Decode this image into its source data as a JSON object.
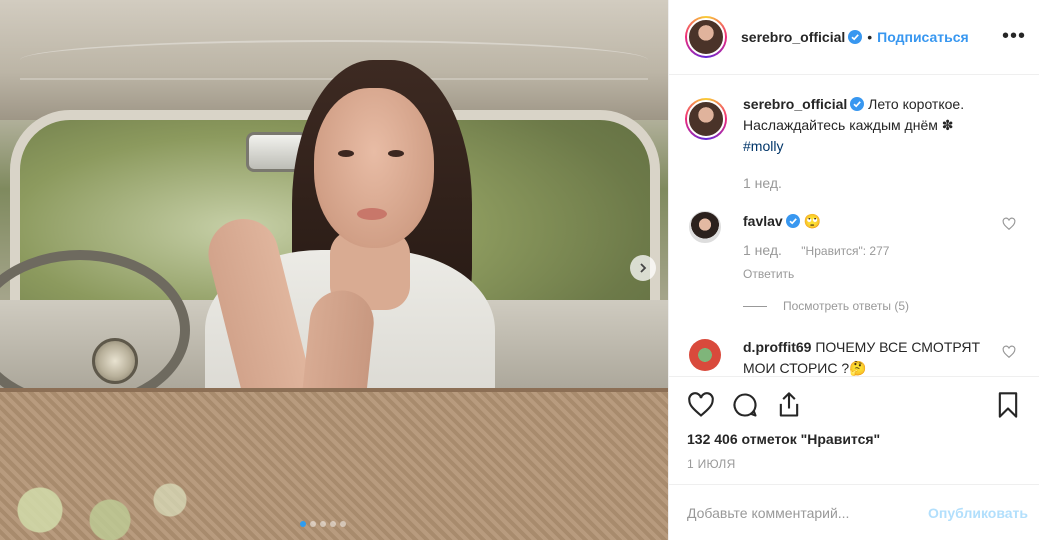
{
  "post": {
    "username": "serebro_official",
    "follow_label": "Подписаться",
    "more_label": "•••",
    "caption_text": "Лето короткое. Наслаждайтесь каждым днём ✽",
    "hashtag": "#molly",
    "caption_time": "1 нед."
  },
  "comments": [
    {
      "username": "favlav",
      "text": "🙄",
      "time": "1 нед.",
      "likes": "\"Нравится\": 277",
      "reply_label": "Ответить",
      "view_replies": "Посмотреть ответы (5)"
    },
    {
      "username": "d.proffit69",
      "text": "ПОЧЕМУ ВСЕ СМОТРЯТ МОИ СТОРИС ?🤔"
    }
  ],
  "actions": {
    "likes_total": "132 406 отметок \"Нравится\"",
    "date": "1 ИЮЛЯ"
  },
  "composer": {
    "placeholder": "Добавьте комментарий...",
    "publish_label": "Опубликовать"
  },
  "carousel": {
    "slides": 5,
    "active": 1
  },
  "colors": {
    "accent": "#3897f0",
    "verified": "#3897f0",
    "muted": "#999999",
    "hashtag": "#003569"
  },
  "icons": [
    "chevron-right-icon",
    "verified-icon",
    "more-icon",
    "heart-icon",
    "comment-icon",
    "share-icon",
    "bookmark-icon"
  ]
}
